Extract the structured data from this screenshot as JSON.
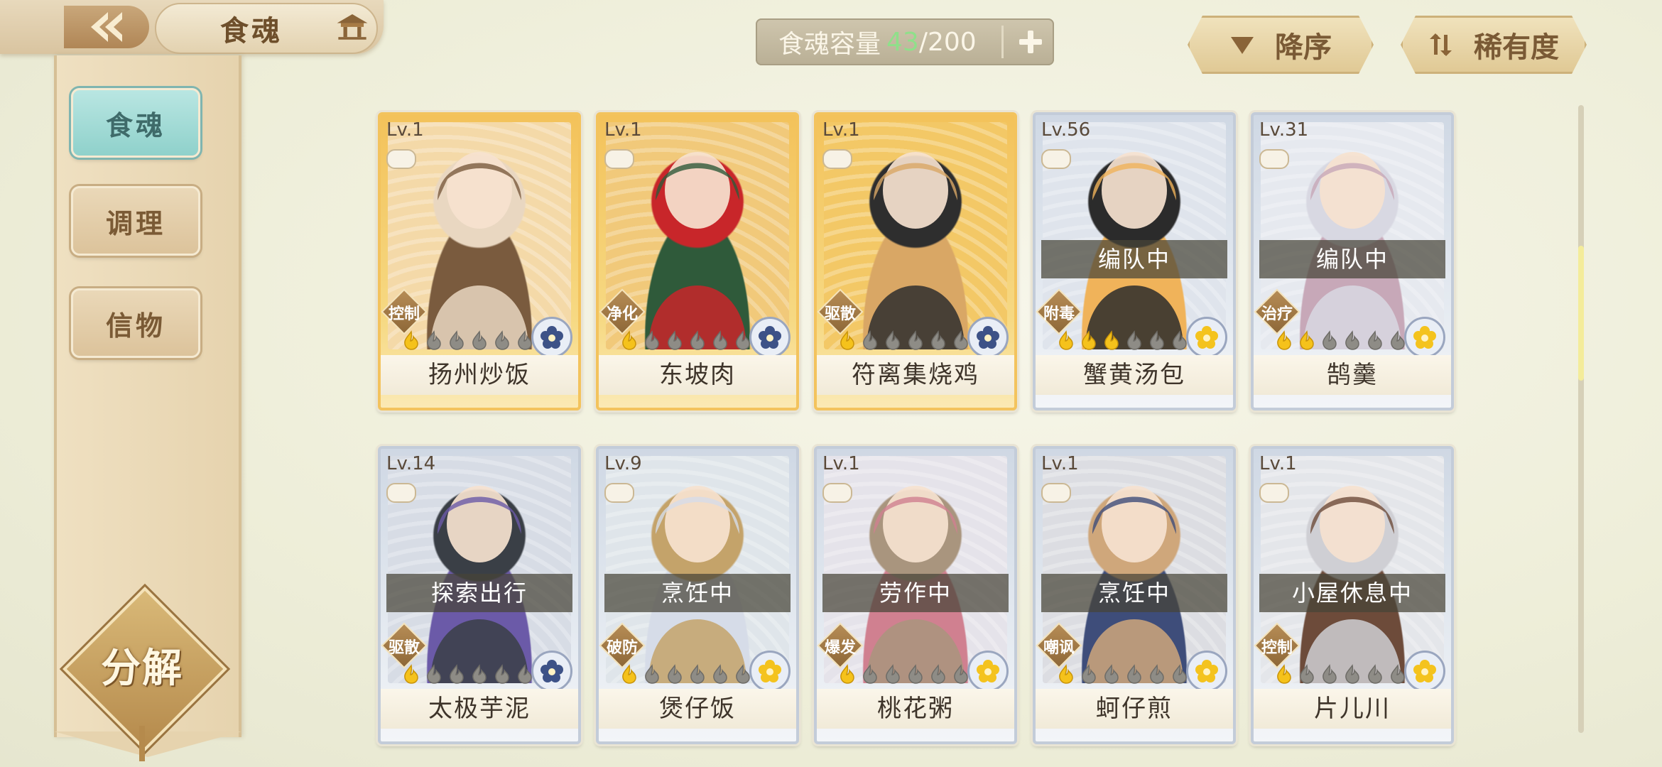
{
  "header": {
    "title": "食魂",
    "back_icon": "back-arrow-icon",
    "home_icon": "pavilion-icon"
  },
  "sidebar": {
    "items": [
      {
        "label": "食魂",
        "active": true
      },
      {
        "label": "调理",
        "active": false
      },
      {
        "label": "信物",
        "active": false
      }
    ],
    "decompose_label": "分解"
  },
  "capacity": {
    "label": "食魂容量",
    "current": "43",
    "separator": "/",
    "max": "200",
    "current_color": "#8fe08a"
  },
  "sort": {
    "order_label": "降序",
    "order_icon": "triangle-down-icon",
    "rarity_label": "稀有度",
    "rarity_icon": "sort-arrows-icon"
  },
  "cards": [
    {
      "level": "Lv.1",
      "name": "扬州炒饭",
      "role": "控制",
      "status": "",
      "stars": 1,
      "frame": "gold",
      "emblem": "blue"
    },
    {
      "level": "Lv.1",
      "name": "东坡肉",
      "role": "净化",
      "status": "",
      "stars": 1,
      "frame": "gold",
      "emblem": "blue"
    },
    {
      "level": "Lv.1",
      "name": "符离集烧鸡",
      "role": "驱散",
      "status": "",
      "stars": 1,
      "frame": "gold",
      "emblem": "blue"
    },
    {
      "level": "Lv.56",
      "name": "蟹黄汤包",
      "role": "附毒",
      "status": "编队中",
      "stars": 3,
      "frame": "silver",
      "emblem": "gold"
    },
    {
      "level": "Lv.31",
      "name": "鹄羹",
      "role": "治疗",
      "status": "编队中",
      "stars": 2,
      "frame": "silver",
      "emblem": "gold"
    },
    {
      "level": "Lv.14",
      "name": "太极芋泥",
      "role": "驱散",
      "status": "探索出行",
      "stars": 1,
      "frame": "silver",
      "emblem": "blue"
    },
    {
      "level": "Lv.9",
      "name": "煲仔饭",
      "role": "破防",
      "status": "烹饪中",
      "stars": 1,
      "frame": "silver",
      "emblem": "gold"
    },
    {
      "level": "Lv.1",
      "name": "桃花粥",
      "role": "爆发",
      "status": "劳作中",
      "stars": 1,
      "frame": "silver",
      "emblem": "gold"
    },
    {
      "level": "Lv.1",
      "name": "蚵仔煎",
      "role": "嘲讽",
      "status": "烹饪中",
      "stars": 1,
      "frame": "silver",
      "emblem": "gold"
    },
    {
      "level": "Lv.1",
      "name": "片儿川",
      "role": "控制",
      "status": "小屋休息中",
      "stars": 1,
      "frame": "silver",
      "emblem": "gold"
    }
  ]
}
